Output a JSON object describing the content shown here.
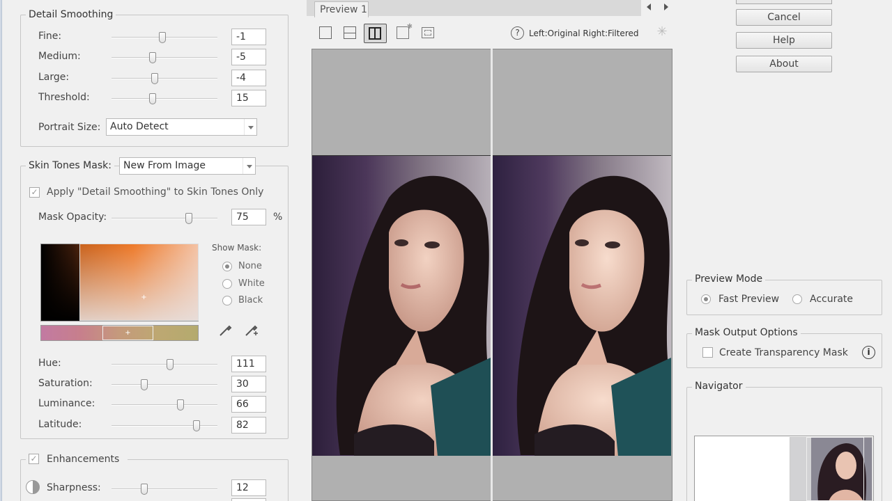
{
  "detail_smoothing": {
    "title": "Detail Smoothing",
    "rows": [
      {
        "label": "Fine:",
        "value": "-1",
        "level": 0.48
      },
      {
        "label": "Medium:",
        "value": "-5",
        "level": 0.39
      },
      {
        "label": "Large:",
        "value": "-4",
        "level": 0.41
      },
      {
        "label": "Threshold:",
        "value": "15",
        "level": 0.39
      }
    ],
    "portrait_label": "Portrait Size:",
    "portrait_value": "Auto Detect"
  },
  "skin_tones": {
    "title": "Skin Tones Mask:",
    "mask_value": "New From Image",
    "apply_label": "Apply \"Detail Smoothing\" to Skin Tones Only",
    "apply_checked": true,
    "mask_opacity_label": "Mask Opacity:",
    "mask_opacity_value": "75",
    "mask_opacity_level": 0.73,
    "percent": "%",
    "show_mask_label": "Show Mask:",
    "show_mask_options": [
      "None",
      "White",
      "Black"
    ],
    "show_mask_selected": "None",
    "rows": [
      {
        "label": "Hue:",
        "value": "111",
        "level": 0.55
      },
      {
        "label": "Saturation:",
        "value": "30",
        "level": 0.31
      },
      {
        "label": "Luminance:",
        "value": "66",
        "level": 0.65
      },
      {
        "label": "Latitude:",
        "value": "82",
        "level": 0.8
      }
    ]
  },
  "enhancements": {
    "title": "Enhancements",
    "checked": true,
    "sharpness_label": "Sharpness:",
    "sharpness_value": "12",
    "sharpness_level": 0.31
  },
  "preview": {
    "tab_label": "Preview 1",
    "compare_label": "Left:Original Right:Filtered"
  },
  "buttons": {
    "cancel": "Cancel",
    "help": "Help",
    "about": "About"
  },
  "preview_mode": {
    "title": "Preview Mode",
    "fast": "Fast Preview",
    "accurate": "Accurate",
    "selected": "Fast Preview"
  },
  "mask_output": {
    "title": "Mask Output Options",
    "transparency_label": "Create Transparency Mask"
  },
  "navigator": {
    "title": "Navigator"
  }
}
